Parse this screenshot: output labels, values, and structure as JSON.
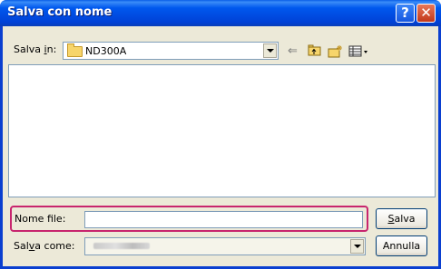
{
  "window": {
    "title": "Salva con nome",
    "help_glyph": "?",
    "close_glyph": "✕"
  },
  "toolbar": {
    "save_in_label": "Salva in:",
    "save_in_label_html": "Salva <u>i</u>n:",
    "current_folder": "ND300A",
    "icons": [
      "back-arrow-icon",
      "up-folder-icon",
      "new-folder-icon",
      "view-menu-icon"
    ]
  },
  "filename": {
    "label": "Nome file:",
    "value": ""
  },
  "filetype": {
    "label": "Salva come:",
    "label_html": "Sal<u>v</u>a come:",
    "value_redacted": true
  },
  "buttons": {
    "save": "Salva",
    "save_html": "<u>S</u>alva",
    "cancel": "Annulla"
  },
  "colors": {
    "titlebar": "#0a3fd0",
    "highlight": "#c8256e",
    "dialog_bg": "#ece9d8"
  }
}
